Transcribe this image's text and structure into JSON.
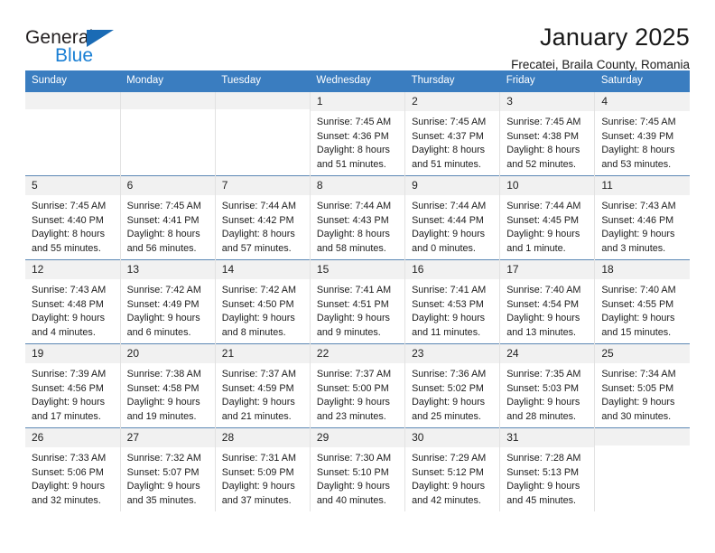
{
  "brand": {
    "name_top": "General",
    "name_bottom": "Blue",
    "accent_color": "#1a7fd4",
    "triangle_color": "#1a6bb5"
  },
  "header": {
    "title": "January 2025",
    "subtitle": "Frecatei, Braila County, Romania"
  },
  "calendar": {
    "header_bg": "#3a7dc0",
    "header_text_color": "#ffffff",
    "daynum_bg": "#f1f1f1",
    "weekday_headers": [
      "Sunday",
      "Monday",
      "Tuesday",
      "Wednesday",
      "Thursday",
      "Friday",
      "Saturday"
    ],
    "weeks": [
      [
        {
          "day": "",
          "empty": true
        },
        {
          "day": "",
          "empty": true
        },
        {
          "day": "",
          "empty": true
        },
        {
          "day": "1",
          "sunrise": "Sunrise: 7:45 AM",
          "sunset": "Sunset: 4:36 PM",
          "daylight1": "Daylight: 8 hours",
          "daylight2": "and 51 minutes."
        },
        {
          "day": "2",
          "sunrise": "Sunrise: 7:45 AM",
          "sunset": "Sunset: 4:37 PM",
          "daylight1": "Daylight: 8 hours",
          "daylight2": "and 51 minutes."
        },
        {
          "day": "3",
          "sunrise": "Sunrise: 7:45 AM",
          "sunset": "Sunset: 4:38 PM",
          "daylight1": "Daylight: 8 hours",
          "daylight2": "and 52 minutes."
        },
        {
          "day": "4",
          "sunrise": "Sunrise: 7:45 AM",
          "sunset": "Sunset: 4:39 PM",
          "daylight1": "Daylight: 8 hours",
          "daylight2": "and 53 minutes."
        }
      ],
      [
        {
          "day": "5",
          "sunrise": "Sunrise: 7:45 AM",
          "sunset": "Sunset: 4:40 PM",
          "daylight1": "Daylight: 8 hours",
          "daylight2": "and 55 minutes."
        },
        {
          "day": "6",
          "sunrise": "Sunrise: 7:45 AM",
          "sunset": "Sunset: 4:41 PM",
          "daylight1": "Daylight: 8 hours",
          "daylight2": "and 56 minutes."
        },
        {
          "day": "7",
          "sunrise": "Sunrise: 7:44 AM",
          "sunset": "Sunset: 4:42 PM",
          "daylight1": "Daylight: 8 hours",
          "daylight2": "and 57 minutes."
        },
        {
          "day": "8",
          "sunrise": "Sunrise: 7:44 AM",
          "sunset": "Sunset: 4:43 PM",
          "daylight1": "Daylight: 8 hours",
          "daylight2": "and 58 minutes."
        },
        {
          "day": "9",
          "sunrise": "Sunrise: 7:44 AM",
          "sunset": "Sunset: 4:44 PM",
          "daylight1": "Daylight: 9 hours",
          "daylight2": "and 0 minutes."
        },
        {
          "day": "10",
          "sunrise": "Sunrise: 7:44 AM",
          "sunset": "Sunset: 4:45 PM",
          "daylight1": "Daylight: 9 hours",
          "daylight2": "and 1 minute."
        },
        {
          "day": "11",
          "sunrise": "Sunrise: 7:43 AM",
          "sunset": "Sunset: 4:46 PM",
          "daylight1": "Daylight: 9 hours",
          "daylight2": "and 3 minutes."
        }
      ],
      [
        {
          "day": "12",
          "sunrise": "Sunrise: 7:43 AM",
          "sunset": "Sunset: 4:48 PM",
          "daylight1": "Daylight: 9 hours",
          "daylight2": "and 4 minutes."
        },
        {
          "day": "13",
          "sunrise": "Sunrise: 7:42 AM",
          "sunset": "Sunset: 4:49 PM",
          "daylight1": "Daylight: 9 hours",
          "daylight2": "and 6 minutes."
        },
        {
          "day": "14",
          "sunrise": "Sunrise: 7:42 AM",
          "sunset": "Sunset: 4:50 PM",
          "daylight1": "Daylight: 9 hours",
          "daylight2": "and 8 minutes."
        },
        {
          "day": "15",
          "sunrise": "Sunrise: 7:41 AM",
          "sunset": "Sunset: 4:51 PM",
          "daylight1": "Daylight: 9 hours",
          "daylight2": "and 9 minutes."
        },
        {
          "day": "16",
          "sunrise": "Sunrise: 7:41 AM",
          "sunset": "Sunset: 4:53 PM",
          "daylight1": "Daylight: 9 hours",
          "daylight2": "and 11 minutes."
        },
        {
          "day": "17",
          "sunrise": "Sunrise: 7:40 AM",
          "sunset": "Sunset: 4:54 PM",
          "daylight1": "Daylight: 9 hours",
          "daylight2": "and 13 minutes."
        },
        {
          "day": "18",
          "sunrise": "Sunrise: 7:40 AM",
          "sunset": "Sunset: 4:55 PM",
          "daylight1": "Daylight: 9 hours",
          "daylight2": "and 15 minutes."
        }
      ],
      [
        {
          "day": "19",
          "sunrise": "Sunrise: 7:39 AM",
          "sunset": "Sunset: 4:56 PM",
          "daylight1": "Daylight: 9 hours",
          "daylight2": "and 17 minutes."
        },
        {
          "day": "20",
          "sunrise": "Sunrise: 7:38 AM",
          "sunset": "Sunset: 4:58 PM",
          "daylight1": "Daylight: 9 hours",
          "daylight2": "and 19 minutes."
        },
        {
          "day": "21",
          "sunrise": "Sunrise: 7:37 AM",
          "sunset": "Sunset: 4:59 PM",
          "daylight1": "Daylight: 9 hours",
          "daylight2": "and 21 minutes."
        },
        {
          "day": "22",
          "sunrise": "Sunrise: 7:37 AM",
          "sunset": "Sunset: 5:00 PM",
          "daylight1": "Daylight: 9 hours",
          "daylight2": "and 23 minutes."
        },
        {
          "day": "23",
          "sunrise": "Sunrise: 7:36 AM",
          "sunset": "Sunset: 5:02 PM",
          "daylight1": "Daylight: 9 hours",
          "daylight2": "and 25 minutes."
        },
        {
          "day": "24",
          "sunrise": "Sunrise: 7:35 AM",
          "sunset": "Sunset: 5:03 PM",
          "daylight1": "Daylight: 9 hours",
          "daylight2": "and 28 minutes."
        },
        {
          "day": "25",
          "sunrise": "Sunrise: 7:34 AM",
          "sunset": "Sunset: 5:05 PM",
          "daylight1": "Daylight: 9 hours",
          "daylight2": "and 30 minutes."
        }
      ],
      [
        {
          "day": "26",
          "sunrise": "Sunrise: 7:33 AM",
          "sunset": "Sunset: 5:06 PM",
          "daylight1": "Daylight: 9 hours",
          "daylight2": "and 32 minutes."
        },
        {
          "day": "27",
          "sunrise": "Sunrise: 7:32 AM",
          "sunset": "Sunset: 5:07 PM",
          "daylight1": "Daylight: 9 hours",
          "daylight2": "and 35 minutes."
        },
        {
          "day": "28",
          "sunrise": "Sunrise: 7:31 AM",
          "sunset": "Sunset: 5:09 PM",
          "daylight1": "Daylight: 9 hours",
          "daylight2": "and 37 minutes."
        },
        {
          "day": "29",
          "sunrise": "Sunrise: 7:30 AM",
          "sunset": "Sunset: 5:10 PM",
          "daylight1": "Daylight: 9 hours",
          "daylight2": "and 40 minutes."
        },
        {
          "day": "30",
          "sunrise": "Sunrise: 7:29 AM",
          "sunset": "Sunset: 5:12 PM",
          "daylight1": "Daylight: 9 hours",
          "daylight2": "and 42 minutes."
        },
        {
          "day": "31",
          "sunrise": "Sunrise: 7:28 AM",
          "sunset": "Sunset: 5:13 PM",
          "daylight1": "Daylight: 9 hours",
          "daylight2": "and 45 minutes."
        },
        {
          "day": "",
          "empty": true
        }
      ]
    ]
  }
}
